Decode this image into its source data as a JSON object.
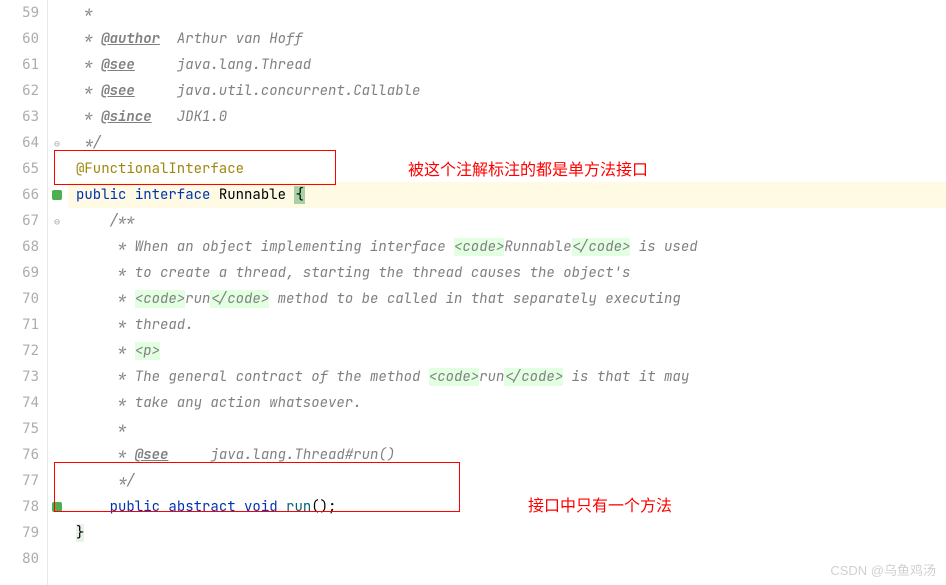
{
  "lines": {
    "start": 59,
    "numbers": [
      "59",
      "60",
      "61",
      "62",
      "63",
      "64",
      "65",
      "66",
      "67",
      "68",
      "69",
      "70",
      "71",
      "72",
      "73",
      "74",
      "75",
      "76",
      "77",
      "78",
      "79",
      "80"
    ]
  },
  "code": {
    "l59": " *",
    "l60_pre": " * ",
    "l60_tag": "@author",
    "l60_post": "  Arthur van Hoff",
    "l61_pre": " * ",
    "l61_tag": "@see",
    "l61_post": "     java.lang.Thread",
    "l62_pre": " * ",
    "l62_tag": "@see",
    "l62_post": "     java.util.concurrent.Callable",
    "l63_pre": " * ",
    "l63_tag": "@since",
    "l63_post": "   JDK1.0",
    "l64": " */",
    "l65_annotation": "@FunctionalInterface",
    "l66_public": "public",
    "l66_interface": "interface",
    "l66_name": "Runnable",
    "l66_brace": "{",
    "l67": "    /**",
    "l68_pre": "     * When an object implementing interface ",
    "l68_code1": "<code>",
    "l68_mid": "Runnable",
    "l68_code2": "</code>",
    "l68_post": " is used",
    "l69": "     * to create a thread, starting the thread causes the object's",
    "l70_pre": "     * ",
    "l70_code1": "<code>",
    "l70_mid": "run",
    "l70_code2": "</code>",
    "l70_post": " method to be called in that separately executing",
    "l71": "     * thread.",
    "l72_pre": "     * ",
    "l72_p": "<p>",
    "l73_pre": "     * The general contract of the method ",
    "l73_code1": "<code>",
    "l73_mid": "run",
    "l73_code2": "</code>",
    "l73_post": " is that it may",
    "l74": "     * take any action whatsoever.",
    "l75": "     *",
    "l76_pre": "     * ",
    "l76_tag": "@see",
    "l76_post": "     java.lang.Thread#run()",
    "l77": "     */",
    "l78_public": "public",
    "l78_abstract": "abstract",
    "l78_void": "void",
    "l78_method": "run",
    "l78_parens": "();",
    "l79_brace": "}"
  },
  "annotations": {
    "a1": "被这个注解标注的都是单方法接口",
    "a2": "接口中只有一个方法"
  },
  "watermark": "CSDN @乌鱼鸡汤"
}
